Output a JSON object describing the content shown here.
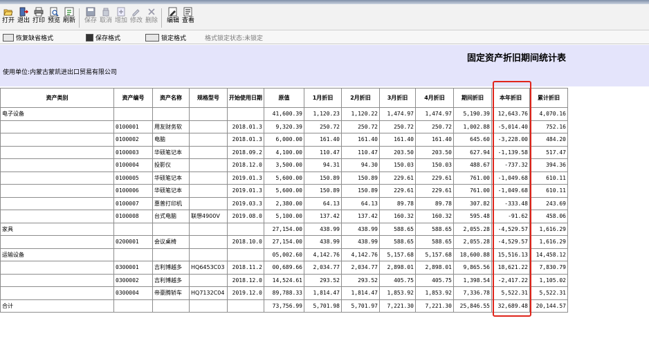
{
  "toolbar": {
    "buttons": [
      {
        "label": "打开",
        "icon": "open-folder-icon"
      },
      {
        "label": "退出",
        "icon": "exit-icon"
      },
      {
        "label": "打印",
        "icon": "printer-icon"
      },
      {
        "label": "预览",
        "icon": "preview-icon"
      },
      {
        "label": "刷新",
        "icon": "refresh-icon"
      },
      {
        "label": "保存",
        "icon": "save-icon"
      },
      {
        "label": "取消",
        "icon": "cancel-icon"
      },
      {
        "label": "增加",
        "icon": "add-icon"
      },
      {
        "label": "修改",
        "icon": "edit-icon"
      },
      {
        "label": "删除",
        "icon": "delete-icon"
      },
      {
        "label": "编辑",
        "icon": "edit-report-icon"
      },
      {
        "label": "查看",
        "icon": "view-icon"
      }
    ]
  },
  "format_bar": {
    "restore_default": "恢复缺省格式",
    "save_format": "保存格式",
    "lock_format": "锁定格式",
    "lock_status": "格式锁定状态:未锁定"
  },
  "report": {
    "title": "固定资产折旧期间统计表",
    "unit": "使用单位:内蒙古蒙凯进出口贸易有限公司"
  },
  "table": {
    "columns": [
      "资产类别",
      "资产编号",
      "资产名称",
      "规格型号",
      "开始使用日期",
      "原值",
      "1月折旧",
      "2月折旧",
      "3月折旧",
      "4月折旧",
      "期间折旧",
      "本年折旧",
      "累计折旧"
    ],
    "rows": [
      [
        "电子设备",
        "",
        "",
        "",
        "",
        "41,600.39",
        "1,120.23",
        "1,120.22",
        "1,474.97",
        "1,474.97",
        "5,190.39",
        "12,643.76",
        "4,070.16"
      ],
      [
        "",
        "0100001",
        "用友财务软",
        "",
        "2018.01.3",
        "9,320.39",
        "250.72",
        "250.72",
        "250.72",
        "250.72",
        "1,002.88",
        "-5,014.40",
        "752.16"
      ],
      [
        "",
        "0100002",
        "电脑",
        "",
        "2018.01.3",
        "6,000.00",
        "161.40",
        "161.40",
        "161.40",
        "161.40",
        "645.60",
        "-3,228.00",
        "484.20"
      ],
      [
        "",
        "0100003",
        "华硕笔记本",
        "",
        "2018.09.2",
        "4,100.00",
        "110.47",
        "110.47",
        "203.50",
        "203.50",
        "627.94",
        "-1,139.58",
        "517.47"
      ],
      [
        "",
        "0100004",
        "投影仪",
        "",
        "2018.12.0",
        "3,500.00",
        "94.31",
        "94.30",
        "150.03",
        "150.03",
        "488.67",
        "-737.32",
        "394.36"
      ],
      [
        "",
        "0100005",
        "华硕笔记本",
        "",
        "2019.01.3",
        "5,600.00",
        "150.89",
        "150.89",
        "229.61",
        "229.61",
        "761.00",
        "-1,049.68",
        "610.11"
      ],
      [
        "",
        "0100006",
        "华硕笔记本",
        "",
        "2019.01.3",
        "5,600.00",
        "150.89",
        "150.89",
        "229.61",
        "229.61",
        "761.00",
        "-1,049.68",
        "610.11"
      ],
      [
        "",
        "0100007",
        "惠普打印机",
        "",
        "2019.03.3",
        "2,380.00",
        "64.13",
        "64.13",
        "89.78",
        "89.78",
        "307.82",
        "-333.48",
        "243.69"
      ],
      [
        "",
        "0100008",
        "台式电脑",
        "联想4900V",
        "2019.08.0",
        "5,100.00",
        "137.42",
        "137.42",
        "160.32",
        "160.32",
        "595.48",
        "-91.62",
        "458.06"
      ],
      [
        "家具",
        "",
        "",
        "",
        "",
        "27,154.00",
        "438.99",
        "438.99",
        "588.65",
        "588.65",
        "2,055.28",
        "-4,529.57",
        "1,616.29"
      ],
      [
        "",
        "0200001",
        "会议桌椅",
        "",
        "2018.10.0",
        "27,154.00",
        "438.99",
        "438.99",
        "588.65",
        "588.65",
        "2,055.28",
        "-4,529.57",
        "1,616.29"
      ],
      [
        "运输设备",
        "",
        "",
        "",
        "",
        "05,002.60",
        "4,142.76",
        "4,142.76",
        "5,157.68",
        "5,157.68",
        "18,600.88",
        "15,516.13",
        "14,458.12"
      ],
      [
        "",
        "0300001",
        "吉利博越多",
        "HQ6453C03",
        "2018.11.2",
        "00,689.66",
        "2,034.77",
        "2,034.77",
        "2,898.01",
        "2,898.01",
        "9,865.56",
        "18,621.22",
        "7,830.79"
      ],
      [
        "",
        "0300002",
        "吉利博越多",
        "",
        "2018.12.0",
        "14,524.61",
        "293.52",
        "293.52",
        "405.75",
        "405.75",
        "1,398.54",
        "-2,417.22",
        "1,105.02"
      ],
      [
        "",
        "0300004",
        "帝豪腾轿车",
        "HQ7132C04",
        "2019.12.0",
        "89,788.33",
        "1,814.47",
        "1,814.47",
        "1,853.92",
        "1,853.92",
        "7,336.78",
        "5,522.31",
        "5,522.31"
      ],
      [
        "合计",
        "",
        "",
        "",
        "",
        "73,756.99",
        "5,701.98",
        "5,701.97",
        "7,221.30",
        "7,221.30",
        "25,846.55",
        "32,689.48",
        "20,144.57"
      ]
    ]
  },
  "colors": {
    "header_band": "#e4e4fb",
    "highlight": "#e0241a"
  }
}
